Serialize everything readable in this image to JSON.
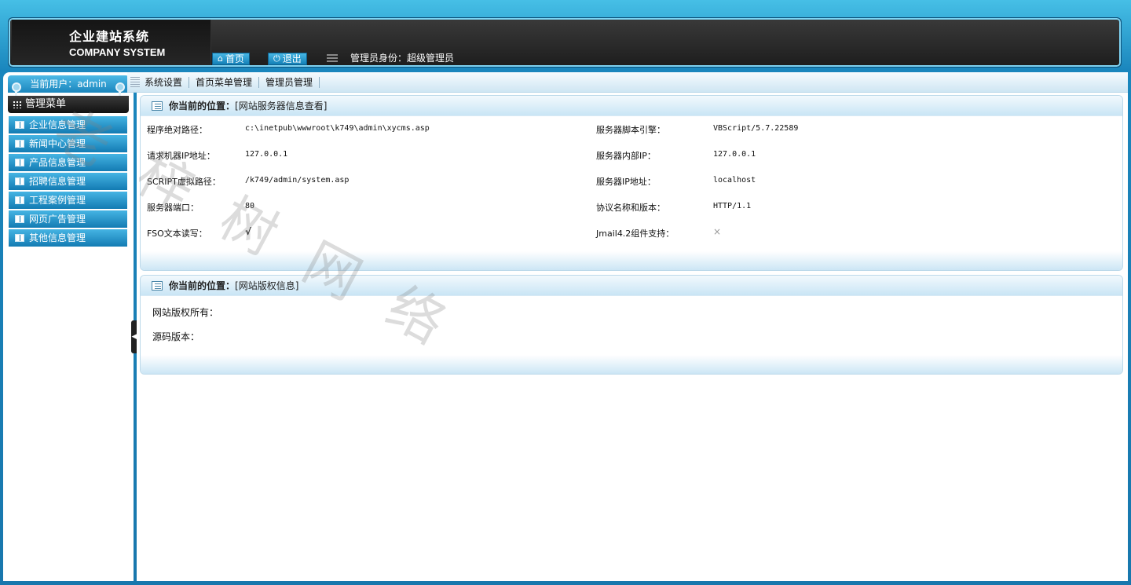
{
  "header": {
    "logo_cn": "企业建站系统",
    "logo_en": "COMPANY SYSTEM",
    "home_label": "首页",
    "logout_label": "退出",
    "role_text": "管理员身份：超级管理员"
  },
  "sidebar": {
    "current_user": "当前用户：admin",
    "menu_title": "管理菜单",
    "items": [
      {
        "label": "企业信息管理"
      },
      {
        "label": "新闻中心管理"
      },
      {
        "label": "产品信息管理"
      },
      {
        "label": "招聘信息管理"
      },
      {
        "label": "工程案例管理"
      },
      {
        "label": "网页广告管理"
      },
      {
        "label": "其他信息管理"
      }
    ]
  },
  "nav": {
    "items": [
      {
        "label": "系统设置"
      },
      {
        "label": "首页菜单管理"
      },
      {
        "label": "管理员管理"
      }
    ]
  },
  "server_panel": {
    "location_label": "你当前的位置：",
    "location_value": "[网站服务器信息查看]",
    "rows": [
      {
        "label": "程序绝对路径：",
        "value": "c:\\inetpub\\wwwroot\\k749\\admin\\xycms.asp",
        "label2": "服务器脚本引擎：",
        "value2": "VBScript/5.7.22589"
      },
      {
        "label": "请求机器IP地址：",
        "value": "127.0.0.1",
        "label2": "服务器内部IP：",
        "value2": "127.0.0.1"
      },
      {
        "label": "SCRIPT虚拟路径：",
        "value": "/k749/admin/system.asp",
        "label2": "服务器IP地址：",
        "value2": "localhost"
      },
      {
        "label": "服务器端口：",
        "value": "80",
        "label2": "协议名称和版本：",
        "value2": "HTTP/1.1"
      },
      {
        "label": "FSO文本读写：",
        "value": "√",
        "label2": "Jmail4.2组件支持：",
        "value2": "×"
      }
    ]
  },
  "copyright_panel": {
    "location_label": "你当前的位置：",
    "location_value": "[网站版权信息]",
    "owner_label": "网站版权所有：",
    "version_label": "源码版本："
  },
  "watermark": "老 梓 树 网 络"
}
